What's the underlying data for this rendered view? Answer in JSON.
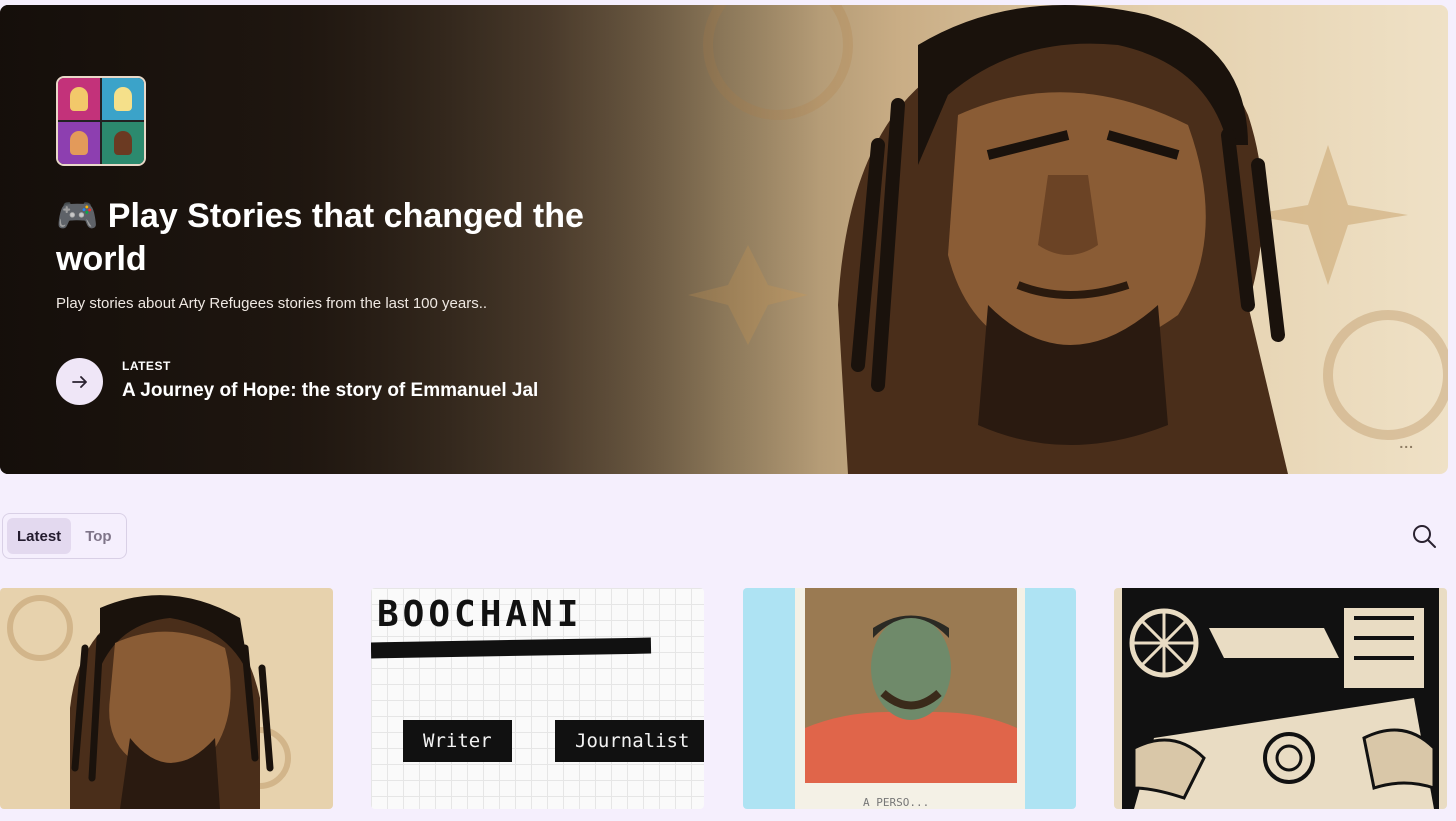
{
  "hero": {
    "emoji": "🎮",
    "title": "Play Stories that changed the world",
    "subtitle": "Play stories about Arty Refugees stories from the last 100 years..",
    "latest_kicker": "LATEST",
    "latest_title": "A Journey of Hope: the story of Emmanuel Jal",
    "more": "..."
  },
  "tabs": [
    {
      "label": "Latest",
      "active": true
    },
    {
      "label": "Top",
      "active": false
    }
  ],
  "cards": [
    {
      "art": "illustrated-portrait-with-dreadlocks"
    },
    {
      "name_text": "BOOCHANI",
      "tags": [
        "Writer",
        "Journalist"
      ]
    },
    {
      "art": "painted-portrait-red-shirt",
      "caption_fragment": "A PERSO..."
    },
    {
      "art": "woodcut-printing-press"
    }
  ],
  "icons": {
    "arrow": "arrow-right-icon",
    "search": "search-icon"
  },
  "colors": {
    "background": "#f5effd",
    "tab_active": "#e3d9ef",
    "button_bg": "#efe6f7"
  }
}
